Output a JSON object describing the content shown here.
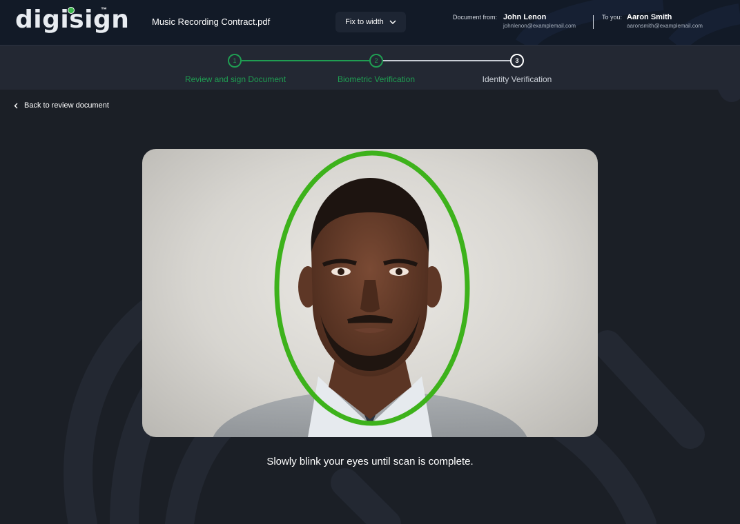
{
  "brand": {
    "name": "digisign",
    "trademark": "™"
  },
  "header": {
    "document_name": "Music Recording Contract.pdf",
    "fit_dropdown": "Fix to width",
    "from_label": "Document from:",
    "from_name": "John Lenon",
    "from_email": "johnlenon@examplemail.com",
    "to_label": "To you:",
    "to_name": "Aaron Smith",
    "to_email": "aaronsmith@examplemail.com"
  },
  "stepper": {
    "steps": [
      {
        "number": "1",
        "label": "Review and sign Document",
        "state": "done"
      },
      {
        "number": "2",
        "label": "Biometric Verification",
        "state": "done"
      },
      {
        "number": "3",
        "label": "Identity Verification",
        "state": "active"
      }
    ]
  },
  "nav": {
    "back_label": "Back to review document"
  },
  "scan": {
    "instruction": "Slowly blink your eyes until scan is complete.",
    "oval_color": "#3db21b"
  },
  "colors": {
    "accent": "#1f9e52",
    "background": "#1b1f26",
    "header": "#121a27"
  }
}
